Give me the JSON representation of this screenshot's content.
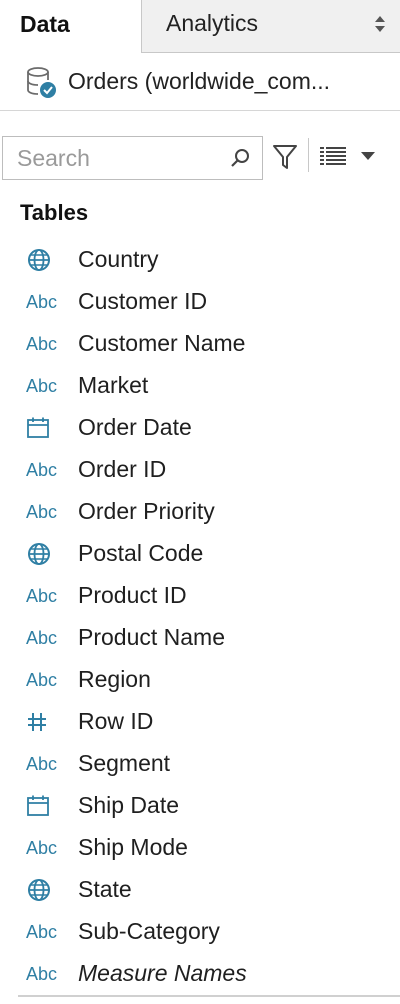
{
  "tabs": {
    "data_label": "Data",
    "analytics_label": "Analytics"
  },
  "datasource": {
    "name": "Orders (worldwide_com...",
    "icon": "database-check-icon"
  },
  "search": {
    "placeholder": "Search"
  },
  "toolbar": {
    "filter_icon": "filter-icon",
    "view_icon": "list-view-icon",
    "menu_icon": "caret-down-icon"
  },
  "section": {
    "title": "Tables"
  },
  "colors": {
    "type_icon": "#2f7fa4",
    "text": "#1f1f1f",
    "inactive_tab_bg": "#f0f0f0"
  },
  "fields": [
    {
      "name": "Country",
      "type": "geo",
      "italic": false
    },
    {
      "name": "Customer ID",
      "type": "string",
      "italic": false
    },
    {
      "name": "Customer Name",
      "type": "string",
      "italic": false
    },
    {
      "name": "Market",
      "type": "string",
      "italic": false
    },
    {
      "name": "Order Date",
      "type": "date",
      "italic": false
    },
    {
      "name": "Order ID",
      "type": "string",
      "italic": false
    },
    {
      "name": "Order Priority",
      "type": "string",
      "italic": false
    },
    {
      "name": "Postal Code",
      "type": "geo",
      "italic": false
    },
    {
      "name": "Product ID",
      "type": "string",
      "italic": false
    },
    {
      "name": "Product Name",
      "type": "string",
      "italic": false
    },
    {
      "name": "Region",
      "type": "string",
      "italic": false
    },
    {
      "name": "Row ID",
      "type": "number",
      "italic": false
    },
    {
      "name": "Segment",
      "type": "string",
      "italic": false
    },
    {
      "name": "Ship Date",
      "type": "date",
      "italic": false
    },
    {
      "name": "Ship Mode",
      "type": "string",
      "italic": false
    },
    {
      "name": "State",
      "type": "geo",
      "italic": false
    },
    {
      "name": "Sub-Category",
      "type": "string",
      "italic": false
    },
    {
      "name": "Measure Names",
      "type": "string",
      "italic": true
    }
  ],
  "type_glyphs": {
    "string": "Abc"
  }
}
